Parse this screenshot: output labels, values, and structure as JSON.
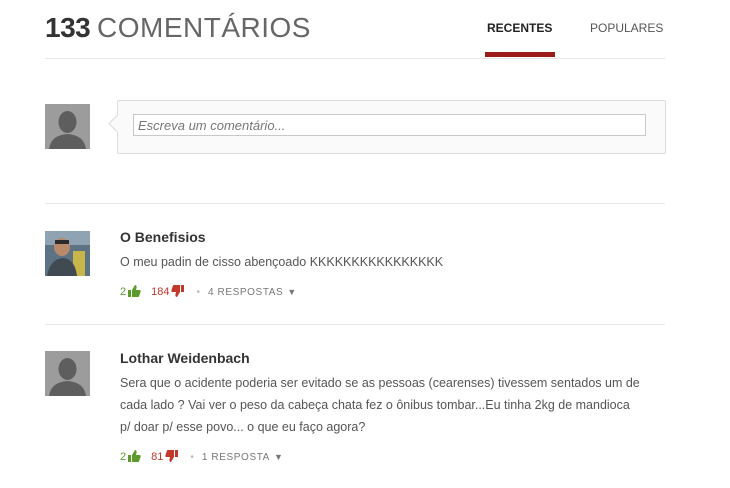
{
  "header": {
    "count": "133",
    "count_label": "COMENTÁRIOS",
    "tabs": [
      {
        "label": "RECENTES",
        "active": true
      },
      {
        "label": "POPULARES",
        "active": false
      }
    ],
    "accent_color": "#9b1b1b"
  },
  "compose": {
    "placeholder": "Escreva um comentário..."
  },
  "comments": [
    {
      "author": "O Benefisios",
      "text": "O meu padin de cisso abençoado KKKKKKKKKKKKKKKK",
      "likes": "2",
      "dislikes": "184",
      "replies_label": "4 RESPOSTAS",
      "avatar": "user-photo"
    },
    {
      "author": "Lothar Weidenbach",
      "text": "Sera que o acidente poderia ser evitado se as pessoas (cearenses) tivessem sentados um de cada lado ? Vai ver o peso da cabeça chata fez o ônibus tombar...Eu tinha 2kg de mandioca p/ doar p/ esse povo... o que eu faço agora?",
      "likes": "2",
      "dislikes": "81",
      "replies_label": "1 RESPOSTA",
      "avatar": "default-avatar"
    }
  ],
  "colors": {
    "like": "#5a9b2b",
    "dislike": "#c0392b"
  }
}
